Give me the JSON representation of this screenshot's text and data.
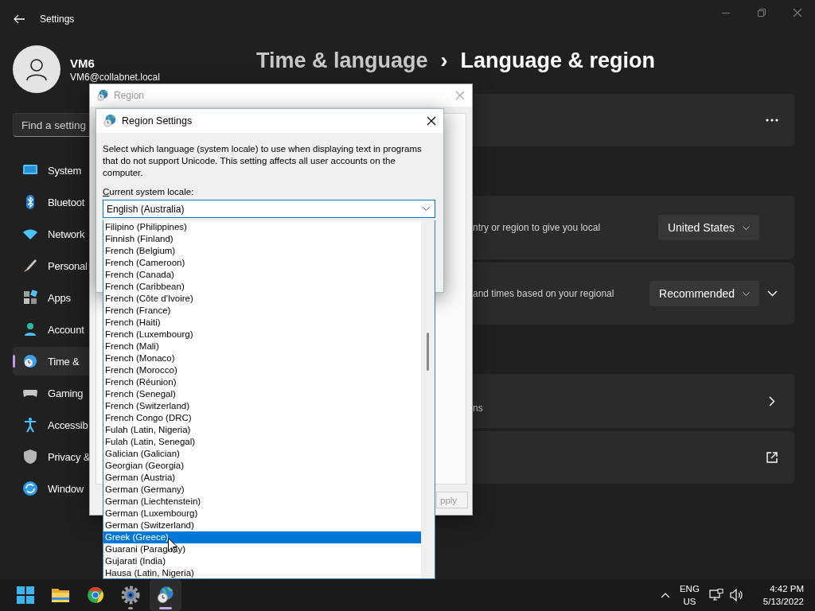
{
  "window": {
    "title": "Settings"
  },
  "profile": {
    "name": "VM6",
    "email": "VM6@collabnet.local"
  },
  "search": {
    "placeholder": "Find a setting"
  },
  "nav": [
    {
      "label": "System",
      "selected": false
    },
    {
      "label": "Bluetoot",
      "selected": false
    },
    {
      "label": "Network",
      "selected": false
    },
    {
      "label": "Personal",
      "selected": false
    },
    {
      "label": "Apps",
      "selected": false
    },
    {
      "label": "Account",
      "selected": false
    },
    {
      "label": "Time &",
      "selected": true
    },
    {
      "label": "Gaming",
      "selected": false
    },
    {
      "label": "Accessib",
      "selected": false
    },
    {
      "label": "Privacy &",
      "selected": false
    },
    {
      "label": "Window",
      "selected": false
    }
  ],
  "breadcrumb": {
    "parent": "Time & language",
    "separator": "›",
    "current": "Language & region"
  },
  "cards": [
    {
      "kind": "menu"
    },
    {
      "kind": "dropdown",
      "description": "ntry or region to give you local",
      "value": "United States"
    },
    {
      "kind": "dropdown",
      "description": "and times based on your regional",
      "value": "Recommended",
      "expanded": false
    },
    {
      "kind": "link",
      "description": "ns"
    },
    {
      "kind": "external"
    }
  ],
  "region_window": {
    "title": "Region",
    "active": false,
    "button": "pply"
  },
  "region_settings": {
    "title": "Region Settings",
    "description": "Select which language (system locale) to use when displaying text in programs that do not support Unicode. This setting affects all user accounts on the computer.",
    "label": "Current system locale:",
    "value": "English (Australia)",
    "options": [
      {
        "label": "Filipino (Philippines)",
        "selected": false
      },
      {
        "label": "Finnish (Finland)",
        "selected": false
      },
      {
        "label": "French (Belgium)",
        "selected": false
      },
      {
        "label": "French (Cameroon)",
        "selected": false
      },
      {
        "label": "French (Canada)",
        "selected": false
      },
      {
        "label": "French (Caribbean)",
        "selected": false
      },
      {
        "label": "French (Côte d'Ivoire)",
        "selected": false
      },
      {
        "label": "French (France)",
        "selected": false
      },
      {
        "label": "French (Haiti)",
        "selected": false
      },
      {
        "label": "French (Luxembourg)",
        "selected": false
      },
      {
        "label": "French (Mali)",
        "selected": false
      },
      {
        "label": "French (Monaco)",
        "selected": false
      },
      {
        "label": "French (Morocco)",
        "selected": false
      },
      {
        "label": "French (Réunion)",
        "selected": false
      },
      {
        "label": "French (Senegal)",
        "selected": false
      },
      {
        "label": "French (Switzerland)",
        "selected": false
      },
      {
        "label": "French Congo (DRC)",
        "selected": false
      },
      {
        "label": "Fulah (Latin, Nigeria)",
        "selected": false
      },
      {
        "label": "Fulah (Latin, Senegal)",
        "selected": false
      },
      {
        "label": "Galician (Galician)",
        "selected": false
      },
      {
        "label": "Georgian (Georgia)",
        "selected": false
      },
      {
        "label": "German (Austria)",
        "selected": false
      },
      {
        "label": "German (Germany)",
        "selected": false
      },
      {
        "label": "German (Liechtenstein)",
        "selected": false
      },
      {
        "label": "German (Luxembourg)",
        "selected": false
      },
      {
        "label": "German (Switzerland)",
        "selected": false
      },
      {
        "label": "Greek (Greece)",
        "selected": true
      },
      {
        "label": "Guarani (Paraguay)",
        "selected": false
      },
      {
        "label": "Gujarati (India)",
        "selected": false
      },
      {
        "label": "Hausa (Latin, Nigeria)",
        "selected": false
      }
    ]
  },
  "taskbar": {
    "apps": [
      {
        "kind": "start",
        "running": false,
        "selected": false
      },
      {
        "kind": "folder",
        "running": false,
        "selected": false
      },
      {
        "kind": "browser",
        "running": false,
        "selected": false
      },
      {
        "kind": "settings",
        "running": true,
        "selected": false
      },
      {
        "kind": "region",
        "running": true,
        "selected": true
      }
    ],
    "language": [
      "ENG",
      "US"
    ],
    "time": "4:42 PM",
    "date": "5/13/2022"
  }
}
